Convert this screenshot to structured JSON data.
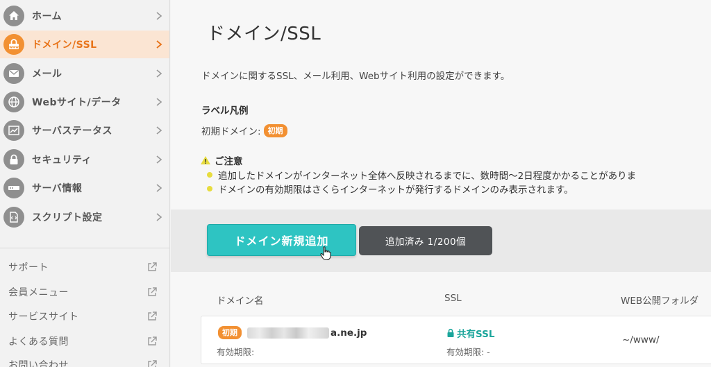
{
  "sidebar": {
    "items": [
      {
        "label": "ホーム",
        "icon": "home-icon"
      },
      {
        "label": "ドメイン/SSL",
        "icon": "domain-lock-icon",
        "active": true
      },
      {
        "label": "メール",
        "icon": "mail-icon"
      },
      {
        "label": "Webサイト/データ",
        "icon": "globe-icon"
      },
      {
        "label": "サーバステータス",
        "icon": "chart-icon"
      },
      {
        "label": "セキュリティ",
        "icon": "lock-icon"
      },
      {
        "label": "サーバ情報",
        "icon": "server-icon"
      },
      {
        "label": "スクリプト設定",
        "icon": "script-icon"
      }
    ],
    "links": [
      {
        "label": "サポート"
      },
      {
        "label": "会員メニュー"
      },
      {
        "label": "サービスサイト"
      },
      {
        "label": "よくある質問"
      },
      {
        "label": "お問い合わせ"
      }
    ]
  },
  "main": {
    "title": "ドメイン/SSL",
    "description": "ドメインに関するSSL、メール利用、Webサイト利用の設定ができます。",
    "legend": {
      "title": "ラベル凡例",
      "row_label": "初期ドメイン:",
      "badge": "初期"
    },
    "notice": {
      "title": "ご注意",
      "bullets": [
        "追加したドメインがインターネット全体へ反映されるまでに、数時間〜2日程度かかることがありま",
        "ドメインの有効期限はさくらインターネットが発行するドメインのみ表示されます。"
      ]
    },
    "actions": {
      "add_button": "ドメイン新規追加",
      "count": "追加済み 1/200個"
    },
    "table": {
      "headers": [
        "ドメイン名",
        "SSL",
        "WEB公開フォルダ"
      ],
      "rows": [
        {
          "badge": "初期",
          "domain_suffix": "a.ne.jp",
          "expiry": "有効期限:",
          "ssl": "共有SSL",
          "ssl_expiry": "有効期限: -",
          "folder": "~/www/"
        }
      ]
    }
  },
  "colors": {
    "accent_orange": "#f29032",
    "teal": "#2ec4c2",
    "ssl_green": "#1aa59b",
    "warning_yellow": "#e7dc3e"
  }
}
